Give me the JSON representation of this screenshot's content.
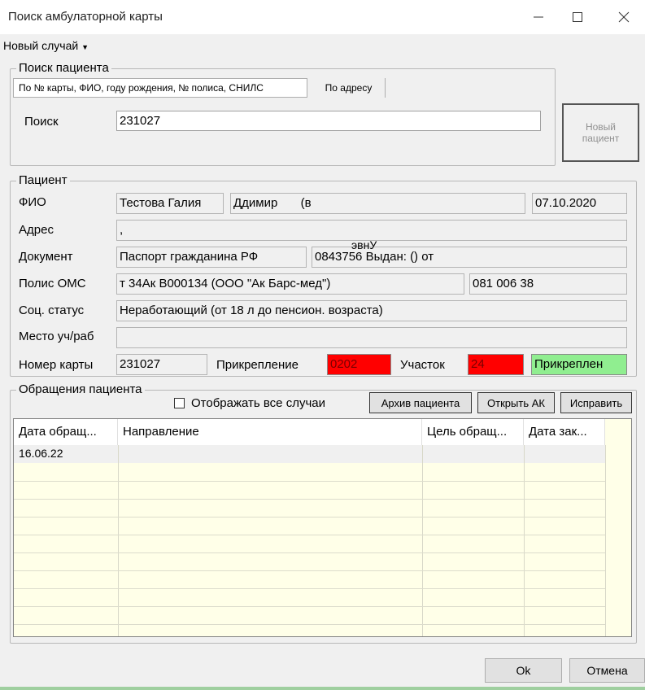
{
  "window": {
    "title": "Поиск амбулаторной карты",
    "minimize_icon": "minimize-icon",
    "maximize_icon": "maximize-icon",
    "close_icon": "close-icon"
  },
  "menu": {
    "new_case": "Новый случай",
    "chevron_icon": "chevron-down-icon"
  },
  "search_group": {
    "title": "Поиск пациента",
    "tabs": [
      {
        "label": "По № карты, ФИО, году рождения, № полиса, СНИЛС"
      },
      {
        "label": "По адресу"
      }
    ],
    "search_label": "Поиск",
    "search_value": "231027",
    "new_patient_button": "Новый пациент"
  },
  "patient": {
    "title": "Пациент",
    "fio_label": "ФИО",
    "fio_last": "Тестова Галия",
    "fio_first": "Ддимир",
    "fio_middle": "(в",
    "birth_date": "07.10.2020",
    "address_label": "Адрес",
    "address_value": ",",
    "document_label": "Документ",
    "document_type": "Паспорт гражданина РФ",
    "document_number": "0843756 Выдан: () от",
    "document_overlay": "эвнУ",
    "oms_label": "Полис ОМС",
    "oms_value": "т 34Ак В000134 (ООО \"Ак Барс-мед\")",
    "oms_number": "081 006 38",
    "social_label": "Соц. статус",
    "social_value": "Неработающий (от 18 л до пенсион. возраста)",
    "work_label": "Место уч/раб",
    "work_value": "",
    "card_label": "Номер карты",
    "card_value": "231027",
    "attach_label": "Прикрепление",
    "attach_value": "0202",
    "district_label": "Участок",
    "district_value": "24",
    "status_value": "Прикреплен"
  },
  "visits": {
    "title": "Обращения пациента",
    "show_all_label": "Отображать все случаи",
    "show_all_checked": false,
    "archive_button": "Архив пациента",
    "open_button": "Открыть АК",
    "fix_button": "Исправить",
    "columns": [
      "Дата обращ...",
      "Направление",
      "Цель обращ...",
      "Дата зак..."
    ],
    "rows": [
      [
        "16.06.22",
        "",
        "",
        ""
      ]
    ]
  },
  "footer": {
    "ok": "Ok",
    "cancel": "Отмена"
  },
  "colors": {
    "red_field": "#ff0000",
    "green_field": "#90ee90",
    "grid_bg": "#ffffe8"
  }
}
